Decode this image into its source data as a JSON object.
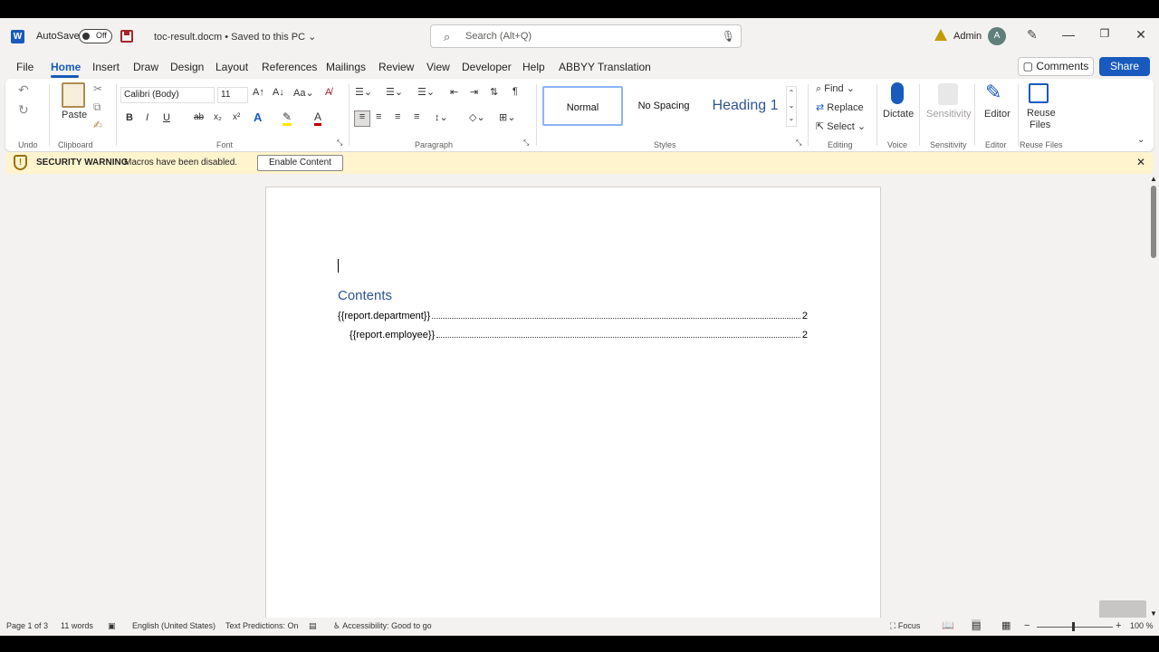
{
  "titlebar": {
    "app_letter": "W",
    "autosave_label": "AutoSave",
    "autosave_state": "Off",
    "doc_title": "toc-result.docm • Saved to this PC",
    "title_caret": "⌄",
    "search_placeholder": "Search (Alt+Q)",
    "user_name": "Admin",
    "user_initial": "A"
  },
  "menu": {
    "items": [
      "File",
      "Home",
      "Insert",
      "Draw",
      "Design",
      "Layout",
      "References",
      "Mailings",
      "Review",
      "View",
      "Developer",
      "Help",
      "ABBYY Translation"
    ],
    "comments_label": "Comments",
    "share_label": "Share"
  },
  "ribbon": {
    "groups": {
      "undo": "Undo",
      "clipboard": "Clipboard",
      "font": "Font",
      "paragraph": "Paragraph",
      "styles": "Styles",
      "editing": "Editing",
      "voice": "Voice",
      "sensitivity": "Sensitivity",
      "editor": "Editor",
      "reuse_files": "Reuse Files"
    },
    "paste_label": "Paste",
    "font_name": "Calibri (Body)",
    "font_size": "11",
    "styles": [
      "Normal",
      "No Spacing",
      "Heading 1"
    ],
    "find_label": "Find",
    "replace_label": "Replace",
    "select_label": "Select",
    "dictate_label": "Dictate",
    "sensitivity_label": "Sensitivity",
    "editor_label": "Editor",
    "reuse_label_1": "Reuse",
    "reuse_label_2": "Files",
    "bold": "B",
    "italic": "I",
    "underline": "U",
    "strike": "ab",
    "subscript": "x₂",
    "superscript": "x²"
  },
  "security_bar": {
    "title": "SECURITY WARNING",
    "message": "Macros have been disabled.",
    "button_label": "Enable Content"
  },
  "document": {
    "toc_heading": "Contents",
    "toc_entries": [
      {
        "text": "{{report.department}}",
        "page": "2"
      },
      {
        "text": "{{report.employee}}",
        "page": "2"
      }
    ]
  },
  "statusbar": {
    "page": "Page 1 of 3",
    "words": "11 words",
    "language": "English (United States)",
    "text_predictions": "Text Predictions: On",
    "accessibility": "Accessibility: Good to go",
    "focus": "Focus",
    "zoom": "100 %"
  },
  "colors": {
    "accent": "#185abd",
    "warning_bg": "#fff4ce",
    "heading": "#2f5496"
  }
}
